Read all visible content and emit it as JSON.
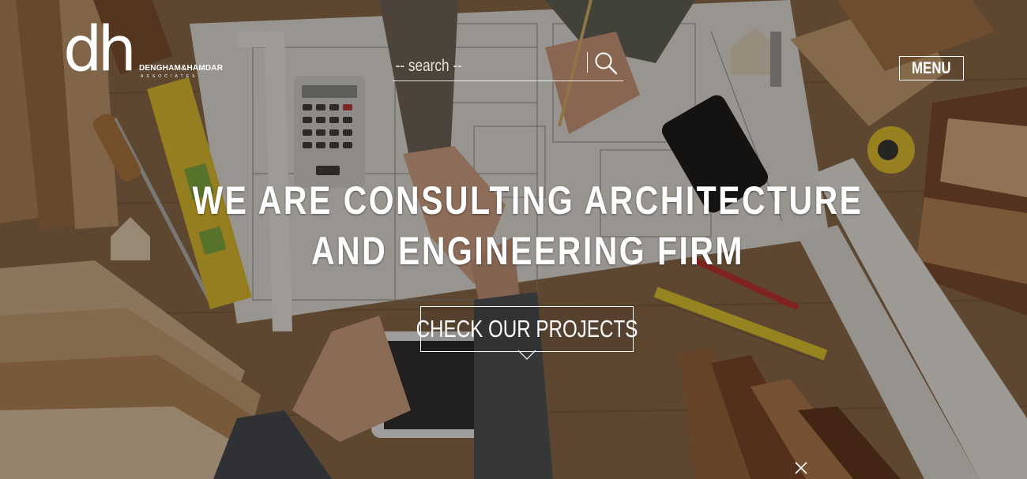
{
  "header": {
    "logo_mark": "dh",
    "logo_name": "DENGHAM&HAMDAR",
    "logo_sub": "ASSOCIATES",
    "menu_label": "MENU"
  },
  "search": {
    "placeholder": "-- search --",
    "icon": "search-icon"
  },
  "hero": {
    "headline_line1": "WE ARE CONSULTING ARCHITECTURE",
    "headline_line2": "AND ENGINEERING FIRM",
    "cta_label": "CHECK OUR PROJECTS"
  },
  "footer": {
    "close_icon": "close-icon"
  },
  "colors": {
    "text": "#ffffff",
    "overlay": "#1a140f"
  }
}
